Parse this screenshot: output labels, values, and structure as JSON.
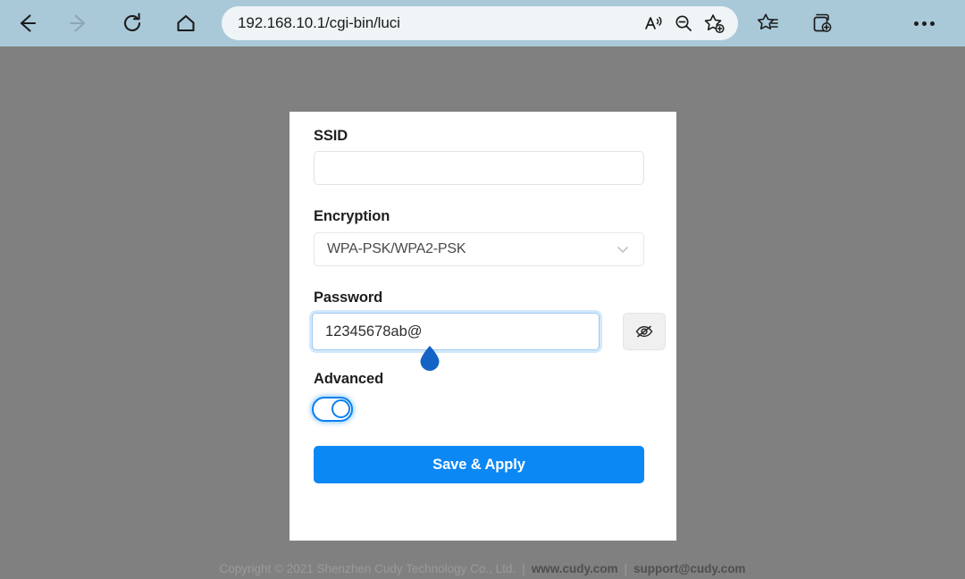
{
  "browser": {
    "url": "192.168.10.1/cgi-bin/luci",
    "nav": {
      "back": "Back",
      "forward": "Forward",
      "refresh": "Refresh",
      "home": "Home"
    },
    "address_icons": {
      "read_aloud": "read-aloud-icon",
      "zoom_out": "zoom-out-icon",
      "add_favorite": "add-favorite-icon"
    },
    "toolbar": {
      "favorites": "Favorites",
      "collections": "Collections",
      "more": "Settings and more"
    }
  },
  "card": {
    "ssid": {
      "label": "SSID",
      "value": "",
      "placeholder": ""
    },
    "encryption": {
      "label": "Encryption",
      "value": "WPA-PSK/WPA2-PSK",
      "options": [
        "WPA-PSK/WPA2-PSK"
      ]
    },
    "password": {
      "label": "Password",
      "value": "12345678ab@",
      "toggle_icon": "eye-off-icon"
    },
    "advanced": {
      "label": "Advanced",
      "state": "off"
    },
    "save_button": "Save & Apply"
  },
  "footer": {
    "copyright": "Copyright © 2021 Shenzhen Cudy Technology Co., Ltd.",
    "separator": "|",
    "website": "www.cudy.com",
    "email": "support@cudy.com"
  },
  "colors": {
    "accent_blue": "#0c88f5",
    "toggle_blue": "#0a7ff0",
    "chrome_bg": "#a9c9d9",
    "page_overlay": "#808080"
  }
}
